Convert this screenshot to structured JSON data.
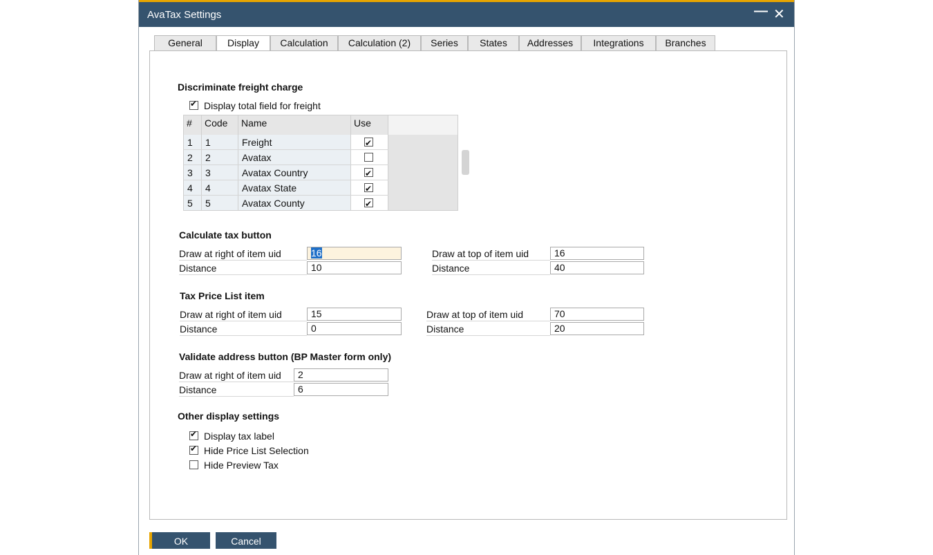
{
  "window": {
    "title": "AvaTax Settings"
  },
  "tabs": [
    "General",
    "Display",
    "Calculation",
    "Calculation (2)",
    "Series",
    "States",
    "Addresses",
    "Integrations",
    "Branches"
  ],
  "active_tab": "Display",
  "freight": {
    "title": "Discriminate freight charge",
    "display_total_label": "Display total field for freight",
    "display_total_checked": true,
    "columns": [
      "#",
      "Code",
      "Name",
      "Use"
    ],
    "rows": [
      {
        "num": "1",
        "code": "1",
        "name": "Freight",
        "use": true
      },
      {
        "num": "2",
        "code": "2",
        "name": "Avatax",
        "use": false
      },
      {
        "num": "3",
        "code": "3",
        "name": "Avatax Country",
        "use": true
      },
      {
        "num": "4",
        "code": "4",
        "name": "Avatax State",
        "use": true
      },
      {
        "num": "5",
        "code": "5",
        "name": "Avatax County",
        "use": true
      }
    ]
  },
  "calc_tax": {
    "title": "Calculate tax button",
    "right_label": "Draw at right of item uid",
    "right_value": "16",
    "distance_label": "Distance",
    "distance_value": "10",
    "top_label": "Draw at top of item uid",
    "top_value": "16",
    "distance2_label": "Distance",
    "distance2_value": "40"
  },
  "price_list": {
    "title": "Tax Price List item",
    "right_label": "Draw at right of item uid",
    "right_value": "15",
    "distance_label": "Distance",
    "distance_value": "0",
    "top_label": "Draw at top of item uid",
    "top_value": "70",
    "distance2_label": "Distance",
    "distance2_value": "20"
  },
  "validate": {
    "title": "Validate address button (BP Master form only)",
    "right_label": "Draw at right of item uid",
    "right_value": "2",
    "distance_label": "Distance",
    "distance_value": "6"
  },
  "other": {
    "title": "Other display settings",
    "items": [
      {
        "label": "Display tax label",
        "checked": true
      },
      {
        "label": "Hide Price List Selection",
        "checked": true
      },
      {
        "label": "Hide Preview Tax",
        "checked": false
      }
    ]
  },
  "buttons": {
    "ok": "OK",
    "cancel": "Cancel"
  },
  "colors": {
    "titlebar": "#35536e",
    "accent": "#e8a500",
    "selection": "#1e6fc8"
  }
}
